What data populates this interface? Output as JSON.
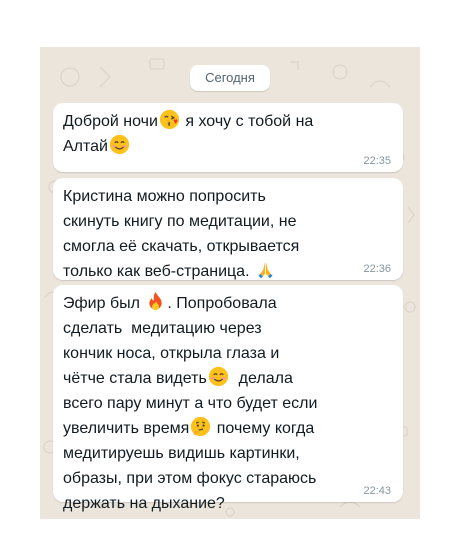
{
  "date_chip": "Сегодня",
  "messages": [
    {
      "text_a": "Доброй ночи",
      "text_b": " я хочу с тобой на\nАлтай",
      "emoji_1": "kissing-face-emoji",
      "emoji_2": "smiling-face-emoji",
      "time": "22:35"
    },
    {
      "text_a": "Кристина можно попросить\nскинуть книгу по медитации, не\nсмогла её скачать, открывается\nтолько как веб-страница. ",
      "emoji_1": "folded-hands-emoji",
      "time": "22:36"
    },
    {
      "text_a": "Эфир был ",
      "text_b": ". Попробовала\nсделать  медитацию через\nкончик носа, открыла глаза и\nчётче стала видеть",
      "text_c": "  делала\nвсего пару минут а что будет если\nувеличить время",
      "text_d": " почему когда\nмедитируешь видишь картинки,\nобразы, при этом фокус стараюсь\nдержать на дыхание?",
      "emoji_1": "fire-emoji",
      "emoji_2": "smiling-face-emoji",
      "emoji_3": "thinking-face-emoji",
      "time": "22:43"
    }
  ],
  "colors": {
    "chat_background": "#ece5dc",
    "bubble": "#ffffff",
    "time_text": "#8696a0",
    "message_text": "#111b21"
  }
}
